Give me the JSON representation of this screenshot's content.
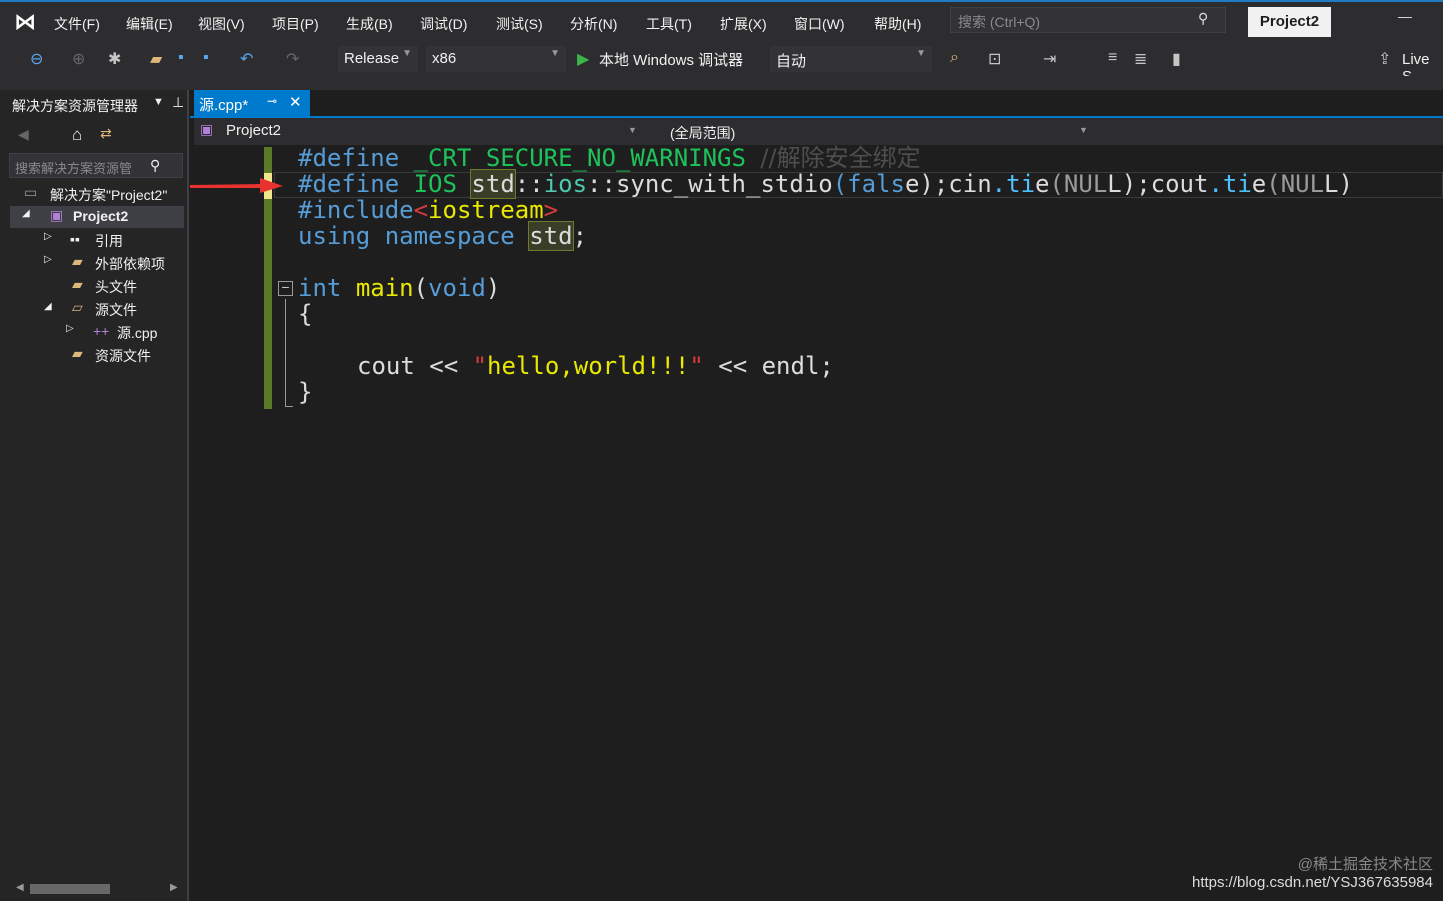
{
  "menu": [
    "文件(F)",
    "编辑(E)",
    "视图(V)",
    "项目(P)",
    "生成(B)",
    "调试(D)",
    "测试(S)",
    "分析(N)",
    "工具(T)",
    "扩展(X)",
    "窗口(W)",
    "帮助(H)"
  ],
  "search_placeholder": "搜索 (Ctrl+Q)",
  "project_badge": "Project2",
  "toolbar": {
    "config": "Release",
    "platform": "x86",
    "debugger": "本地 Windows 调试器",
    "mode": "自动",
    "live_share": "Live S"
  },
  "solution_explorer": {
    "title": "解决方案资源管理器",
    "search_placeholder": "搜索解决方案资源管",
    "items": [
      "解决方案\"Project2\"",
      "Project2",
      "引用",
      "外部依赖项",
      "头文件",
      "源文件",
      "源.cpp",
      "资源文件"
    ]
  },
  "editor": {
    "tab": "源.cpp*",
    "nav_project": "Project2",
    "nav_scope": "(全局范围)",
    "lines": {
      "l1a": "#define",
      "l1b": "_CRT_SECURE_NO_WARNINGS",
      "l1c": "//解除安全绑定",
      "l2": "#define IOS std::ios::sync_with_stdio(false);cin.tie(NULL);cout.tie(NULL)",
      "l3": "#include<iostream>",
      "l4": "using namespace std;",
      "l6": "int main(void)",
      "l7": "{",
      "l9": "cout << \"hello,world!!!\" << endl;",
      "l10": "}"
    }
  },
  "watermark": {
    "line1": "@稀土掘金技术社区",
    "line2": "https://blog.csdn.net/YSJ367635984"
  }
}
